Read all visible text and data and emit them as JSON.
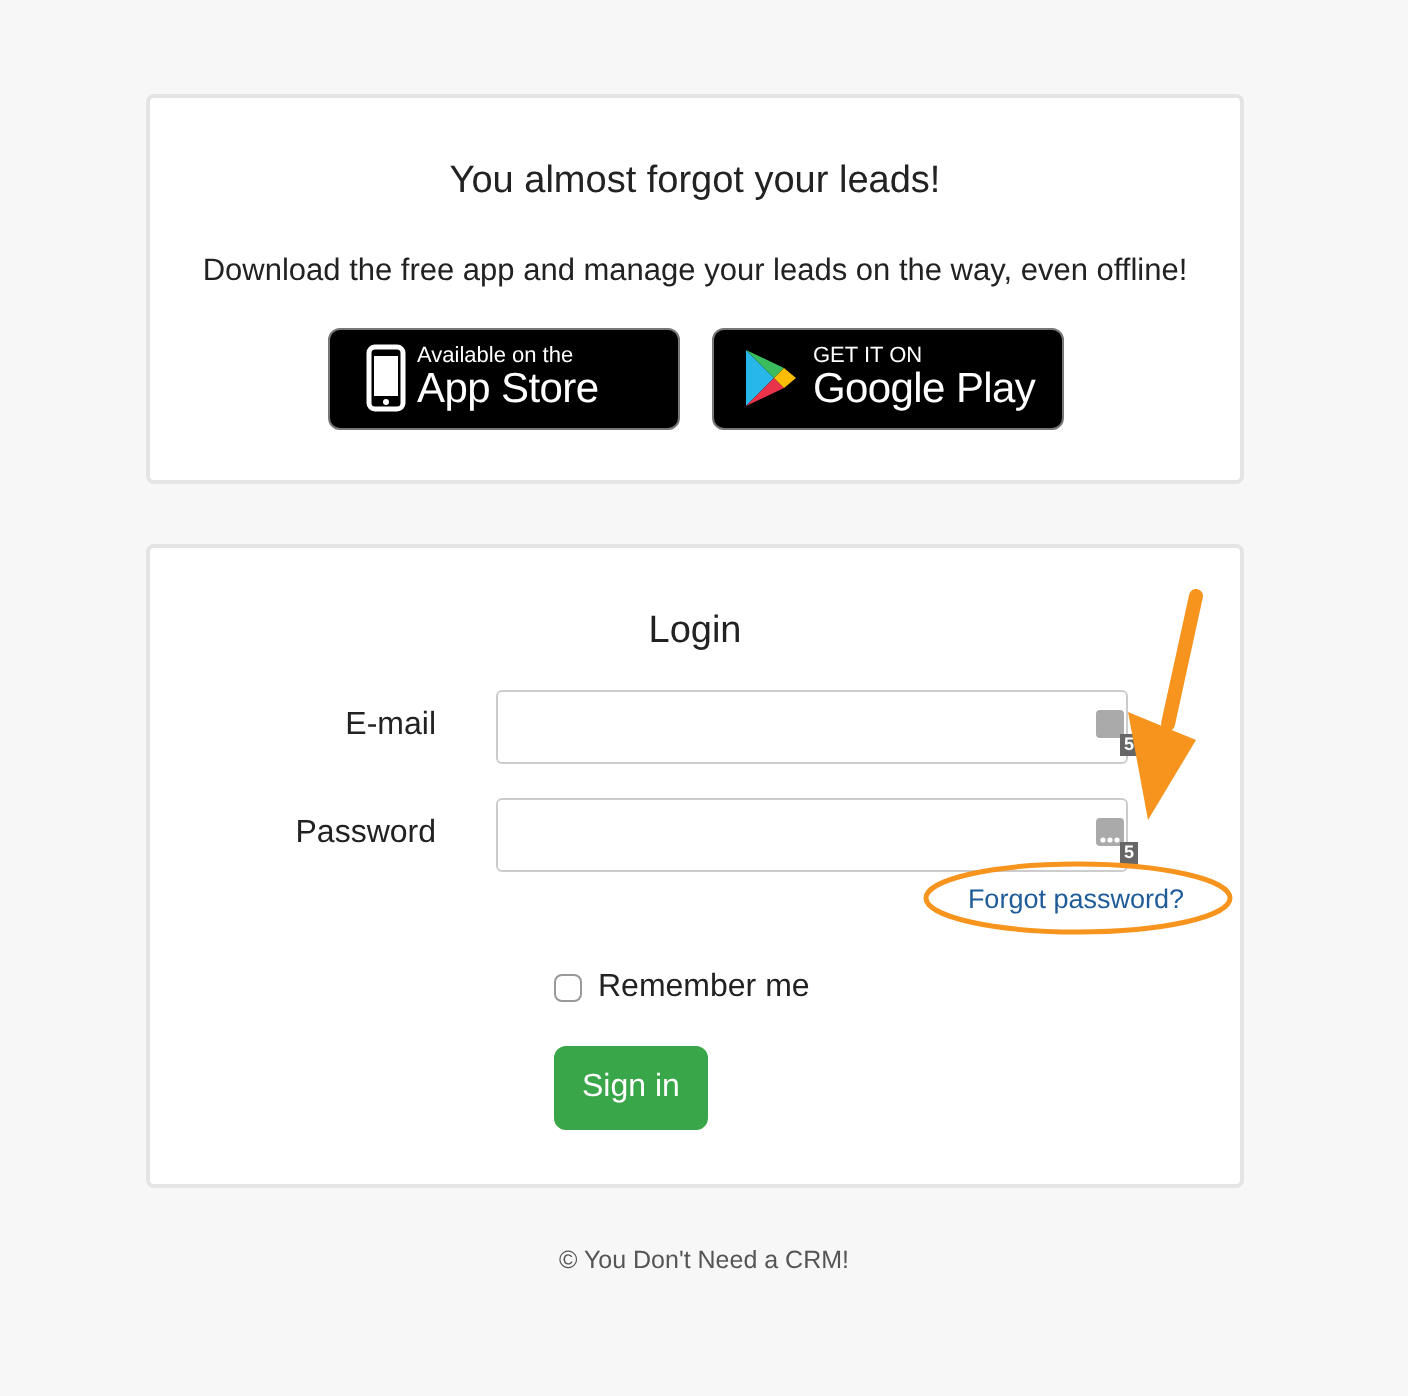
{
  "promo": {
    "title": "You almost forgot your leads!",
    "text": "Download the free app and manage your leads on the way, even offline!",
    "badges": [
      {
        "kind": "appstore",
        "small": "Available on the",
        "big": "App Store"
      },
      {
        "kind": "googleplay",
        "small": "GET IT ON",
        "big": "Google Play"
      }
    ]
  },
  "login": {
    "title": "Login",
    "fields": [
      {
        "label": "E-mail",
        "kind": "email",
        "manager_count": "5"
      },
      {
        "label": "Password",
        "kind": "password",
        "manager_count": "5"
      }
    ],
    "forgot": "Forgot password?",
    "remember": {
      "label": "Remember me",
      "checked": false
    },
    "submit": "Sign in"
  },
  "footer": "© You Don't Need a CRM!"
}
